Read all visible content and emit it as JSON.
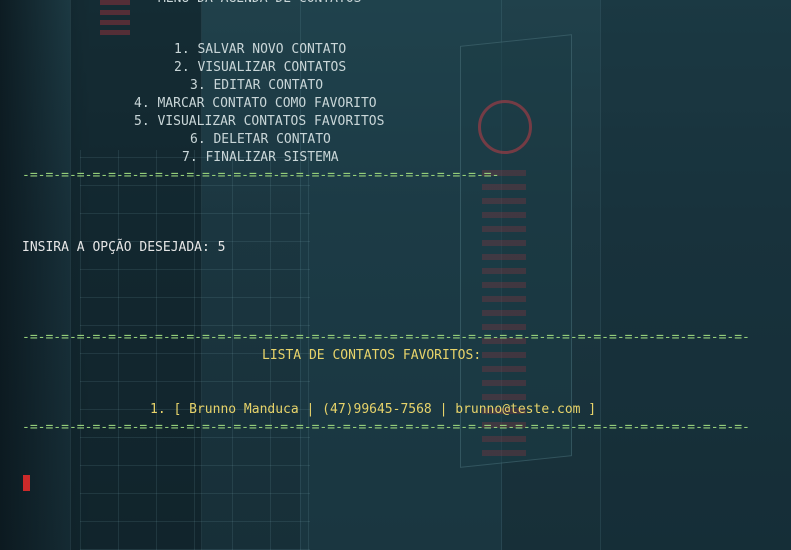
{
  "terminal": {
    "menu_title": "MENU DA AGENDA DE CONTATOS",
    "menu_items": [
      "1. SALVAR NOVO CONTATO",
      "2. VISUALIZAR CONTATOS",
      "3. EDITAR CONTATO",
      "4. MARCAR CONTATO COMO FAVORITO",
      "5. VISUALIZAR CONTATOS FAVORITOS",
      "6. DELETAR CONTATO",
      "7. FINALIZAR SISTEMA"
    ],
    "separator_short": "-=-=-=-=-=-=-=-=-=-=-=-=-=-=-=-=-=-=-=-=-=-=-=-=-=-=-=-=-=-=-",
    "prompt": "INSIRA A OPÇÃO DESEJADA: 5",
    "separator_long": "-=-=-=-=-=-=-=-=-=-=-=-=-=-=-=-=-=-=-=-=-=-=-=-=-=-=-=-=-=-=-=-=-=-=-=-=-=-=-=-=-=-=-=-=-=-=-",
    "favorites_title": "LISTA DE CONTATOS FAVORITOS:",
    "favorites": [
      "1. [ Brunno Manduca | (47)99645-7568 | brunno@teste.com ]"
    ]
  },
  "colors": {
    "menu_text": "#c9d6d8",
    "separator": "#95cf7a",
    "favorites_text": "#e7d36a",
    "cursor": "#cc2a2a"
  }
}
